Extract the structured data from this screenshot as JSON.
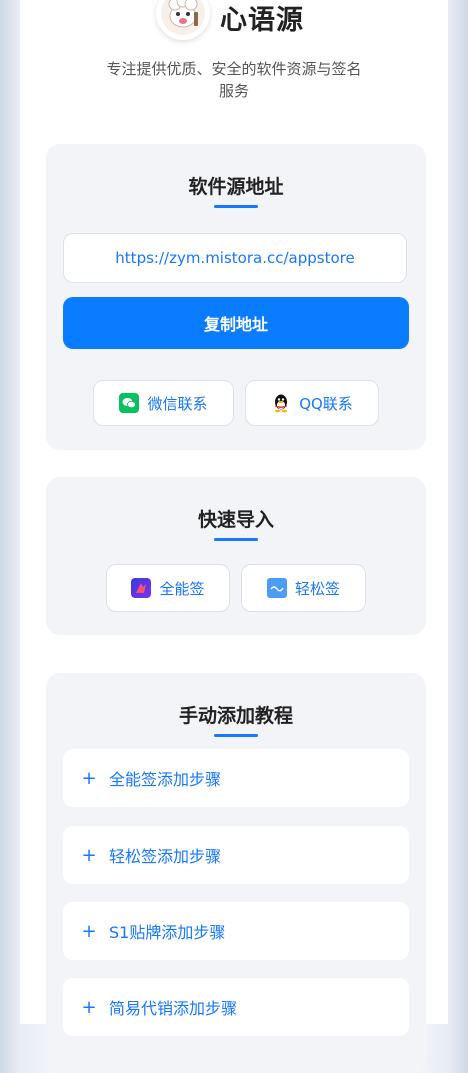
{
  "header": {
    "app_name": "心语源",
    "tagline": "专注提供优质、安全的软件资源与签名服务"
  },
  "source_card": {
    "title": "软件源地址",
    "url": "https://zym.mistora.cc/appstore",
    "copy_label": "复制地址",
    "wechat_label": "微信联系",
    "qq_label": "QQ联系"
  },
  "import_card": {
    "title": "快速导入",
    "quanneng_label": "全能签",
    "qingsong_label": "轻松签"
  },
  "tutorial_card": {
    "title": "手动添加教程",
    "plus": "+",
    "steps": [
      "全能签添加步骤",
      "轻松签添加步骤",
      "S1贴牌添加步骤",
      "简易代销添加步骤"
    ]
  },
  "colors": {
    "accent": "#1677ff",
    "button": "#0a7cff",
    "card_bg": "#f3f4f7",
    "wechat": "#07c160"
  }
}
